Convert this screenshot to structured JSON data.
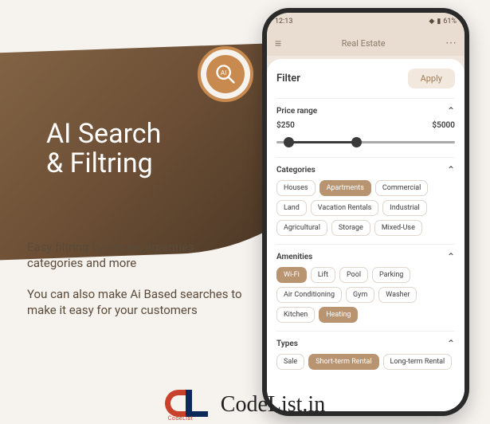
{
  "hero": {
    "line1": "AI Search",
    "line2": "& Filtring"
  },
  "copy": {
    "p1": "Easy filtring by pricee, amenties, categories and more",
    "p2": "You can also make Ai Based searches to make it easy for your customers"
  },
  "footer": {
    "logo_sub": "CodeList",
    "text": "CodeList.in"
  },
  "phone": {
    "status": {
      "time": "12:13",
      "battery": "61%"
    },
    "appbar": {
      "title": "Real Estate"
    },
    "filter": {
      "title": "Filter",
      "apply": "Apply"
    },
    "price": {
      "label": "Price range",
      "min": "$250",
      "max": "$5000"
    },
    "categories": {
      "label": "Categories",
      "items": [
        "Houses",
        "Apartments",
        "Commercial",
        "Land",
        "Vacation Rentals",
        "Industrial",
        "Agricultural",
        "Storage",
        "Mixed-Use"
      ],
      "selected": "Apartments"
    },
    "amenities": {
      "label": "Amenities",
      "items": [
        "Wi-Fi",
        "Lift",
        "Pool",
        "Parking",
        "Air Conditioning",
        "Gym",
        "Washer",
        "Kitchen",
        "Heating"
      ],
      "selected": [
        "Wi-Fi",
        "Heating"
      ]
    },
    "types": {
      "label": "Types",
      "items": [
        "Sale",
        "Short-term Rental",
        "Long-term Rental"
      ],
      "selected": "Short-term Rental"
    }
  }
}
